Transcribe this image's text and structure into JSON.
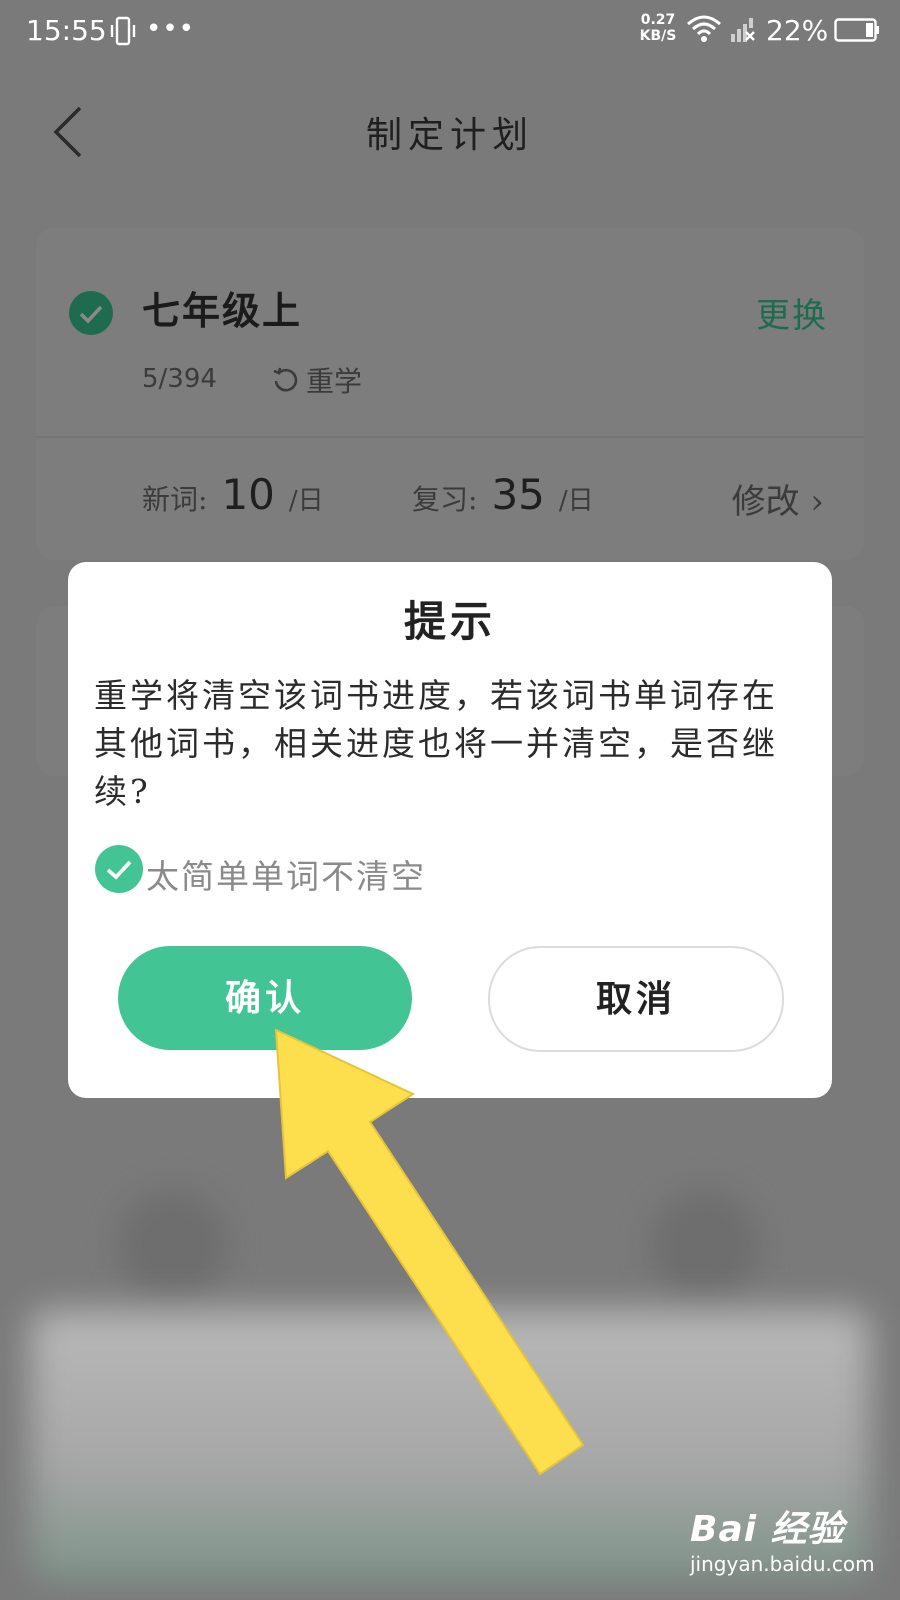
{
  "status_bar": {
    "time": "15:55",
    "more": "•••",
    "net_speed_value": "0.27",
    "net_speed_unit": "KB/S",
    "battery": "22%"
  },
  "header": {
    "title": "制定计划"
  },
  "plan_card": {
    "book_title": "七年级上",
    "change_label": "更换",
    "progress": "5/394",
    "relearn_label": "重学",
    "new_words_label": "新词:",
    "new_words_value": "10",
    "review_label": "复习:",
    "review_value": "35",
    "per_day": "/日",
    "modify_label": "修改 ›"
  },
  "dialog": {
    "title": "提示",
    "message": "重学将清空该词书进度，若该词书单词存在其他词书，相关进度也将一并清空，是否继续?",
    "keep_easy_label": "太简单单词不清空",
    "keep_easy_checked": true,
    "confirm_label": "确认",
    "cancel_label": "取消"
  },
  "watermark": {
    "logo": "Bai 经验",
    "url": "jingyan.baidu.com"
  },
  "colors": {
    "accent": "#43c495",
    "accent_dim": "#1f6b4f",
    "overlay": "#7a7a7a",
    "arrow": "#fddf4e"
  }
}
